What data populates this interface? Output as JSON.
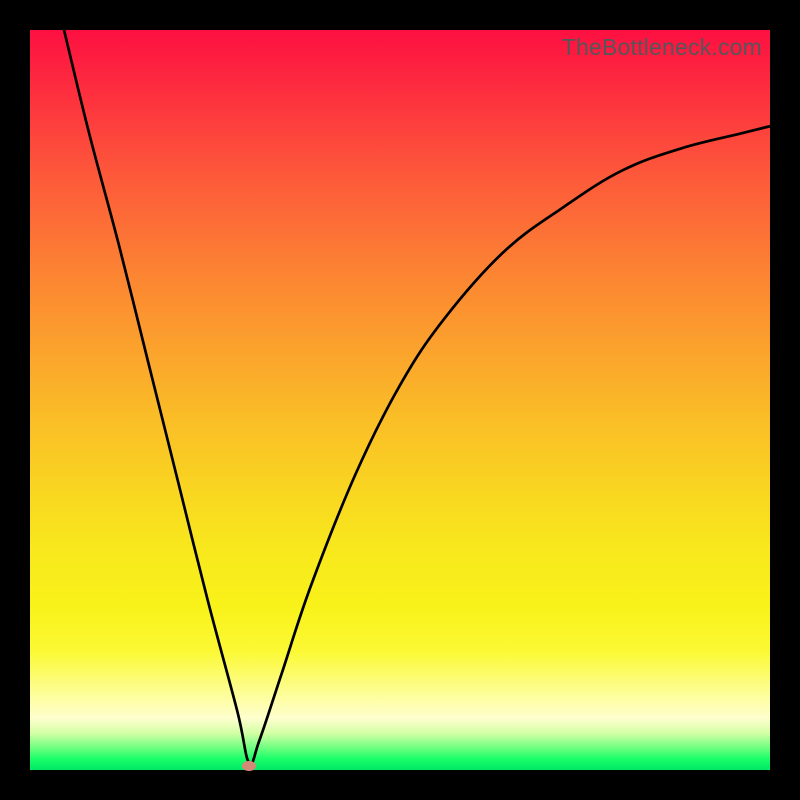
{
  "watermark": "TheBottleneck.com",
  "colors": {
    "frame": "#000000",
    "curve": "#000000",
    "marker": "#d58a78",
    "gradient_stops": [
      "#fd1041",
      "#fd5a3a",
      "#fba52c",
      "#f9d521",
      "#f8e81d",
      "#fdfd8c",
      "#6eff80",
      "#00e765"
    ]
  },
  "chart_data": {
    "type": "line",
    "title": "",
    "xlabel": "",
    "ylabel": "",
    "ylim": [
      0,
      1
    ],
    "xlim": [
      0,
      1
    ],
    "x": [
      0.046,
      0.08,
      0.12,
      0.16,
      0.2,
      0.24,
      0.28,
      0.296,
      0.31,
      0.34,
      0.38,
      0.44,
      0.5,
      0.56,
      0.64,
      0.72,
      0.8,
      0.88,
      0.96,
      1.0
    ],
    "values": [
      1.0,
      0.86,
      0.71,
      0.55,
      0.39,
      0.23,
      0.08,
      0.01,
      0.04,
      0.13,
      0.25,
      0.4,
      0.52,
      0.61,
      0.7,
      0.76,
      0.81,
      0.84,
      0.86,
      0.87
    ],
    "note": "y is normalized curve height above the green baseline (0 = at baseline, 1 = at top); minimum at x≈0.296",
    "marker": {
      "x": 0.296,
      "y": 0.006
    },
    "series": [
      {
        "name": "bottleneck-curve",
        "x_key": "x",
        "y_key": "values"
      }
    ]
  }
}
